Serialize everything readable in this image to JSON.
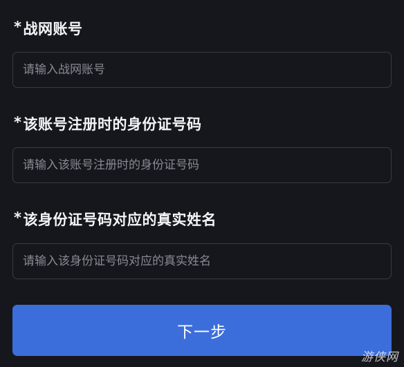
{
  "form": {
    "required_mark": "*",
    "fields": [
      {
        "label": "战网账号",
        "placeholder": "请输入战网账号",
        "value": ""
      },
      {
        "label": "该账号注册时的身份证号码",
        "placeholder": "请输入该账号注册时的身份证号码",
        "value": ""
      },
      {
        "label": "该身份证号码对应的真实姓名",
        "placeholder": "请输入该身份证号码对应的真实姓名",
        "value": ""
      }
    ],
    "submit_label": "下一步"
  },
  "watermark": "游侠网",
  "colors": {
    "background": "#16161d",
    "button": "#3c6edb",
    "input_border": "#3a3a44",
    "placeholder": "#8a8a94"
  }
}
